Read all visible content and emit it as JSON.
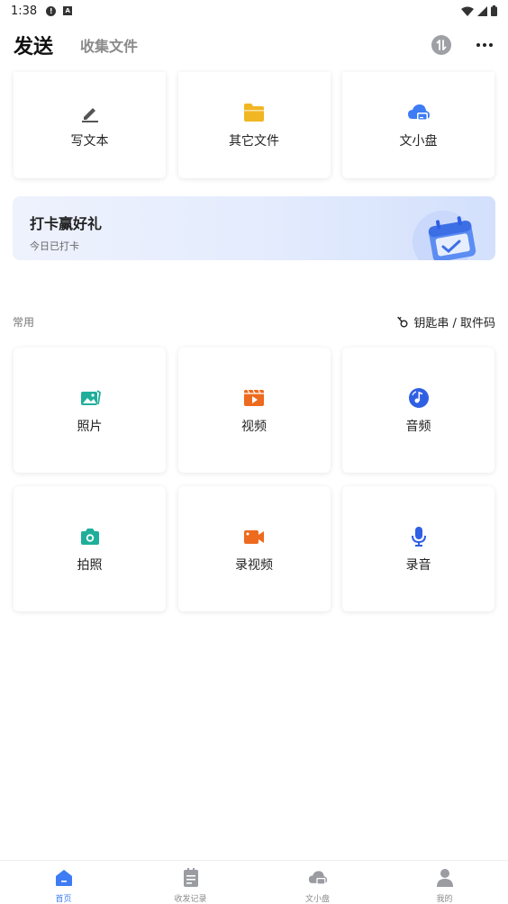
{
  "status": {
    "time": "1:38"
  },
  "header": {
    "title": "发送",
    "tab": "收集文件"
  },
  "top_cards": [
    {
      "label": "写文本",
      "icon": "pencil-icon"
    },
    {
      "label": "其它文件",
      "icon": "folder-icon"
    },
    {
      "label": "文小盘",
      "icon": "cloud-drive-icon"
    }
  ],
  "banner": {
    "title": "打卡赢好礼",
    "subtitle": "今日已打卡"
  },
  "section": {
    "title": "常用",
    "link": "钥匙串 / 取件码"
  },
  "grid": [
    {
      "label": "照片",
      "icon": "photo-icon",
      "color": "#1fae9a"
    },
    {
      "label": "视频",
      "icon": "video-icon",
      "color": "#ee6a1e"
    },
    {
      "label": "音频",
      "icon": "audio-icon",
      "color": "#2f5fe3"
    },
    {
      "label": "拍照",
      "icon": "camera-icon",
      "color": "#1fae9a"
    },
    {
      "label": "录视频",
      "icon": "video-camera-icon",
      "color": "#ee6a1e"
    },
    {
      "label": "录音",
      "icon": "microphone-icon",
      "color": "#2f5fe3"
    }
  ],
  "nav": [
    {
      "label": "首页",
      "icon": "home-icon",
      "active": true
    },
    {
      "label": "收发记录",
      "icon": "records-icon",
      "active": false
    },
    {
      "label": "文小盘",
      "icon": "cloud-drive-icon",
      "active": false
    },
    {
      "label": "我的",
      "icon": "profile-icon",
      "active": false
    }
  ],
  "colors": {
    "accent": "#3d7cf5",
    "folder": "#f0b623",
    "cloud": "#3d7cf5"
  }
}
